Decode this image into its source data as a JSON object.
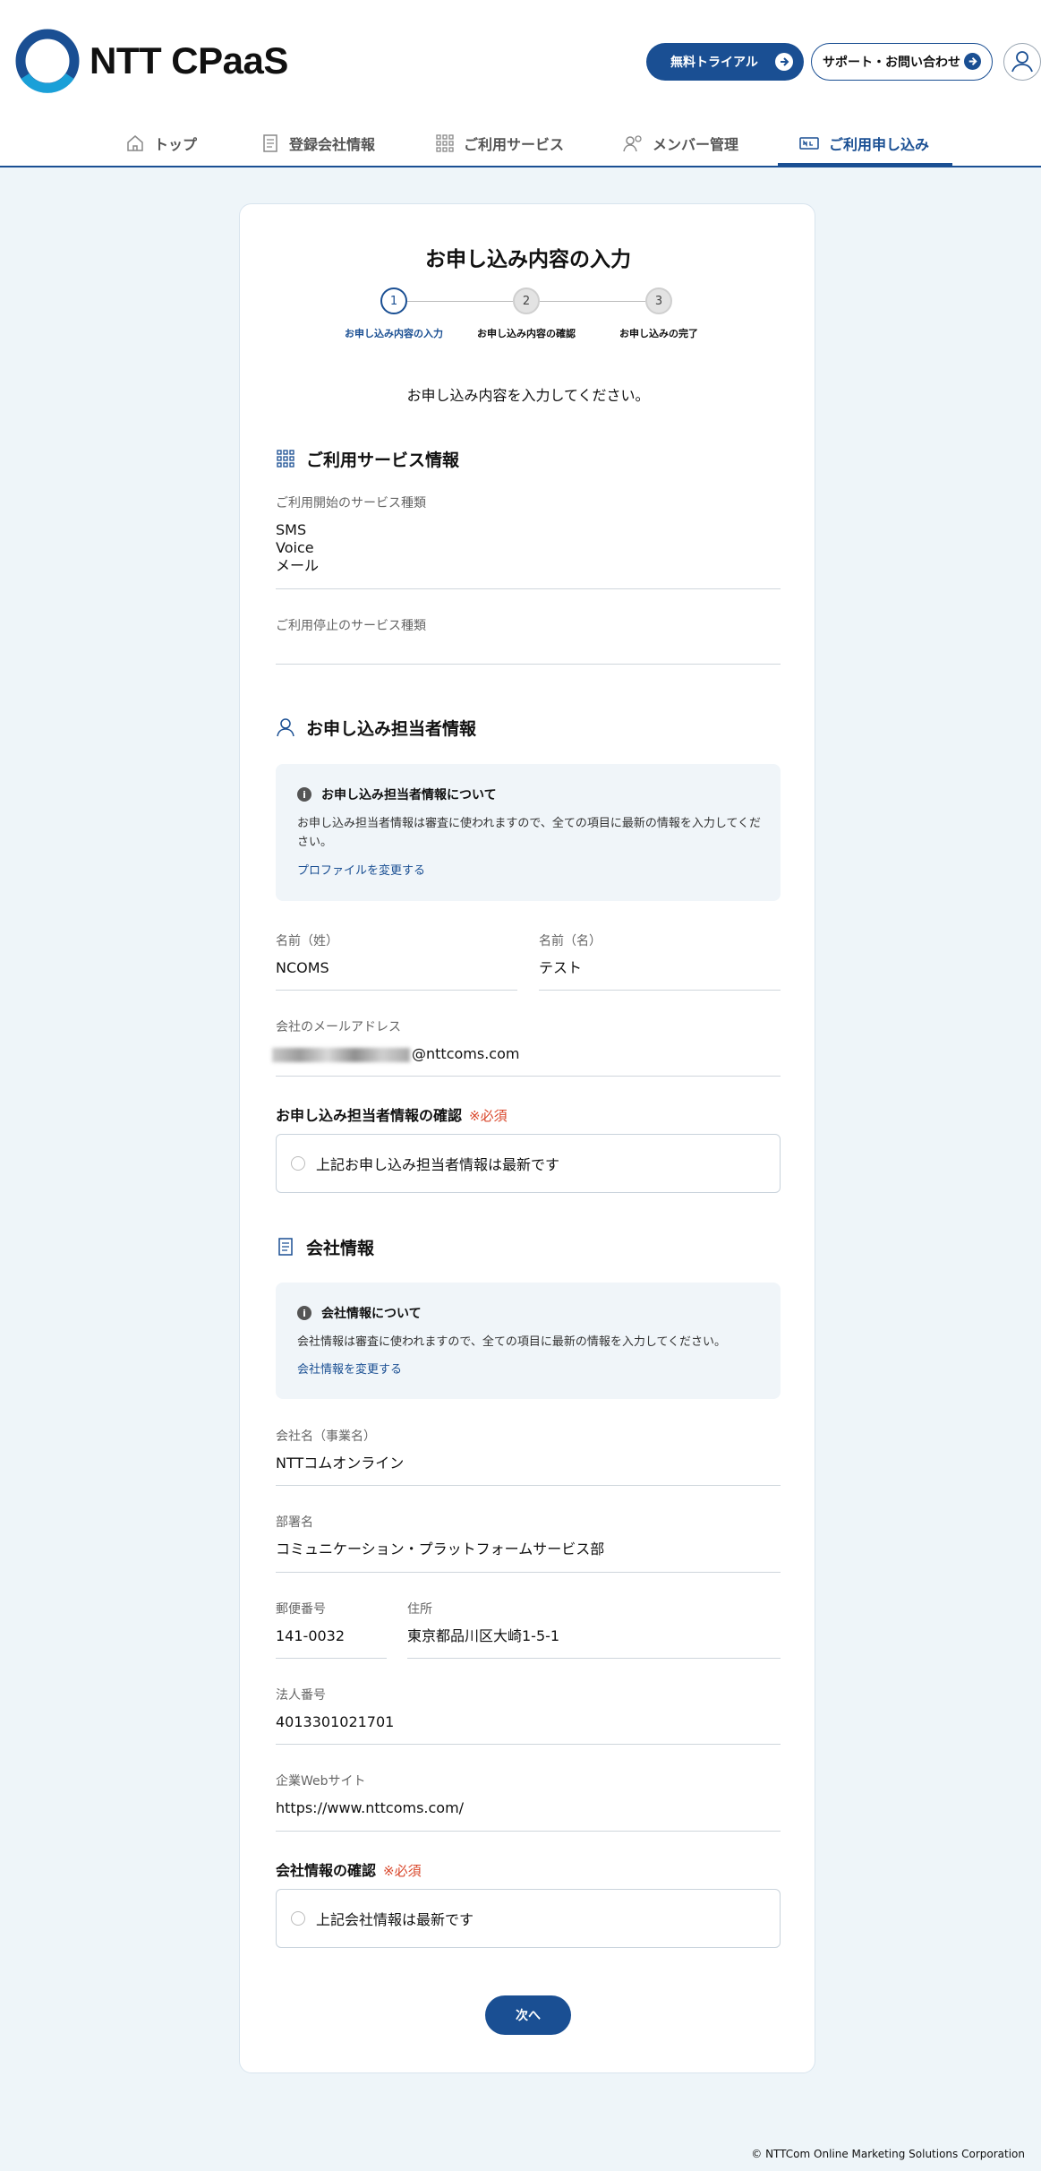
{
  "header": {
    "brand": "NTT CPaaS",
    "trial_button": "無料トライアル",
    "support_button": "サポート・お問い合わせ"
  },
  "nav": {
    "items": [
      {
        "label": "トップ",
        "icon": "home-icon"
      },
      {
        "label": "登録会社情報",
        "icon": "document-icon"
      },
      {
        "label": "ご利用サービス",
        "icon": "grid-icon"
      },
      {
        "label": "メンバー管理",
        "icon": "member-icon"
      },
      {
        "label": "ご利用申し込み",
        "icon": "application-icon"
      }
    ],
    "active": "ご利用申し込み"
  },
  "page": {
    "title": "お申し込み内容の入力",
    "steps": [
      {
        "num": "1",
        "label": "お申し込み内容の入力"
      },
      {
        "num": "2",
        "label": "お申し込み内容の確認"
      },
      {
        "num": "3",
        "label": "お申し込みの完了"
      }
    ],
    "intro": "お申し込み内容を入力してください。"
  },
  "service": {
    "title": "ご利用サービス情報",
    "start_label": "ご利用開始のサービス種類",
    "start_values": [
      "SMS",
      "Voice",
      "メール"
    ],
    "stop_label": "ご利用停止のサービス種類"
  },
  "applicant": {
    "title": "お申し込み担当者情報",
    "info_title": "お申し込み担当者情報について",
    "info_body": "お申し込み担当者情報は審査に使われますので、全ての項目に最新の情報を入力してください。",
    "info_link": "プロファイルを変更する",
    "last_name_label": "名前（姓）",
    "last_name": "NCOMS",
    "first_name_label": "名前（名）",
    "first_name": "テスト",
    "email_label": "会社のメールアドレス",
    "email_domain": "@nttcoms.com",
    "confirm_title": "お申し込み担当者情報の確認",
    "required": "※必須",
    "confirm_check": "上記お申し込み担当者情報は最新です"
  },
  "company": {
    "title": "会社情報",
    "info_title": "会社情報について",
    "info_body": "会社情報は審査に使われますので、全ての項目に最新の情報を入力してください。",
    "info_link": "会社情報を変更する",
    "name_label": "会社名（事業名）",
    "name": "NTTコムオンライン",
    "dept_label": "部署名",
    "dept": "コミュニケーション・プラットフォームサービス部",
    "zip_label": "郵便番号",
    "zip": "141-0032",
    "address_label": "住所",
    "address": "東京都品川区大崎1-5-1",
    "corp_no_label": "法人番号",
    "corp_no": "4013301021701",
    "web_label": "企業Webサイト",
    "web": "https://www.nttcoms.com/",
    "confirm_title": "会社情報の確認",
    "required": "※必須",
    "confirm_check": "上記会社情報は最新です"
  },
  "next_button": "次へ",
  "footer": "© NTTCom Online Marketing Solutions Corporation",
  "colors": {
    "primary": "#1a4f93",
    "required": "#d9472b",
    "background": "#eef5f9"
  }
}
